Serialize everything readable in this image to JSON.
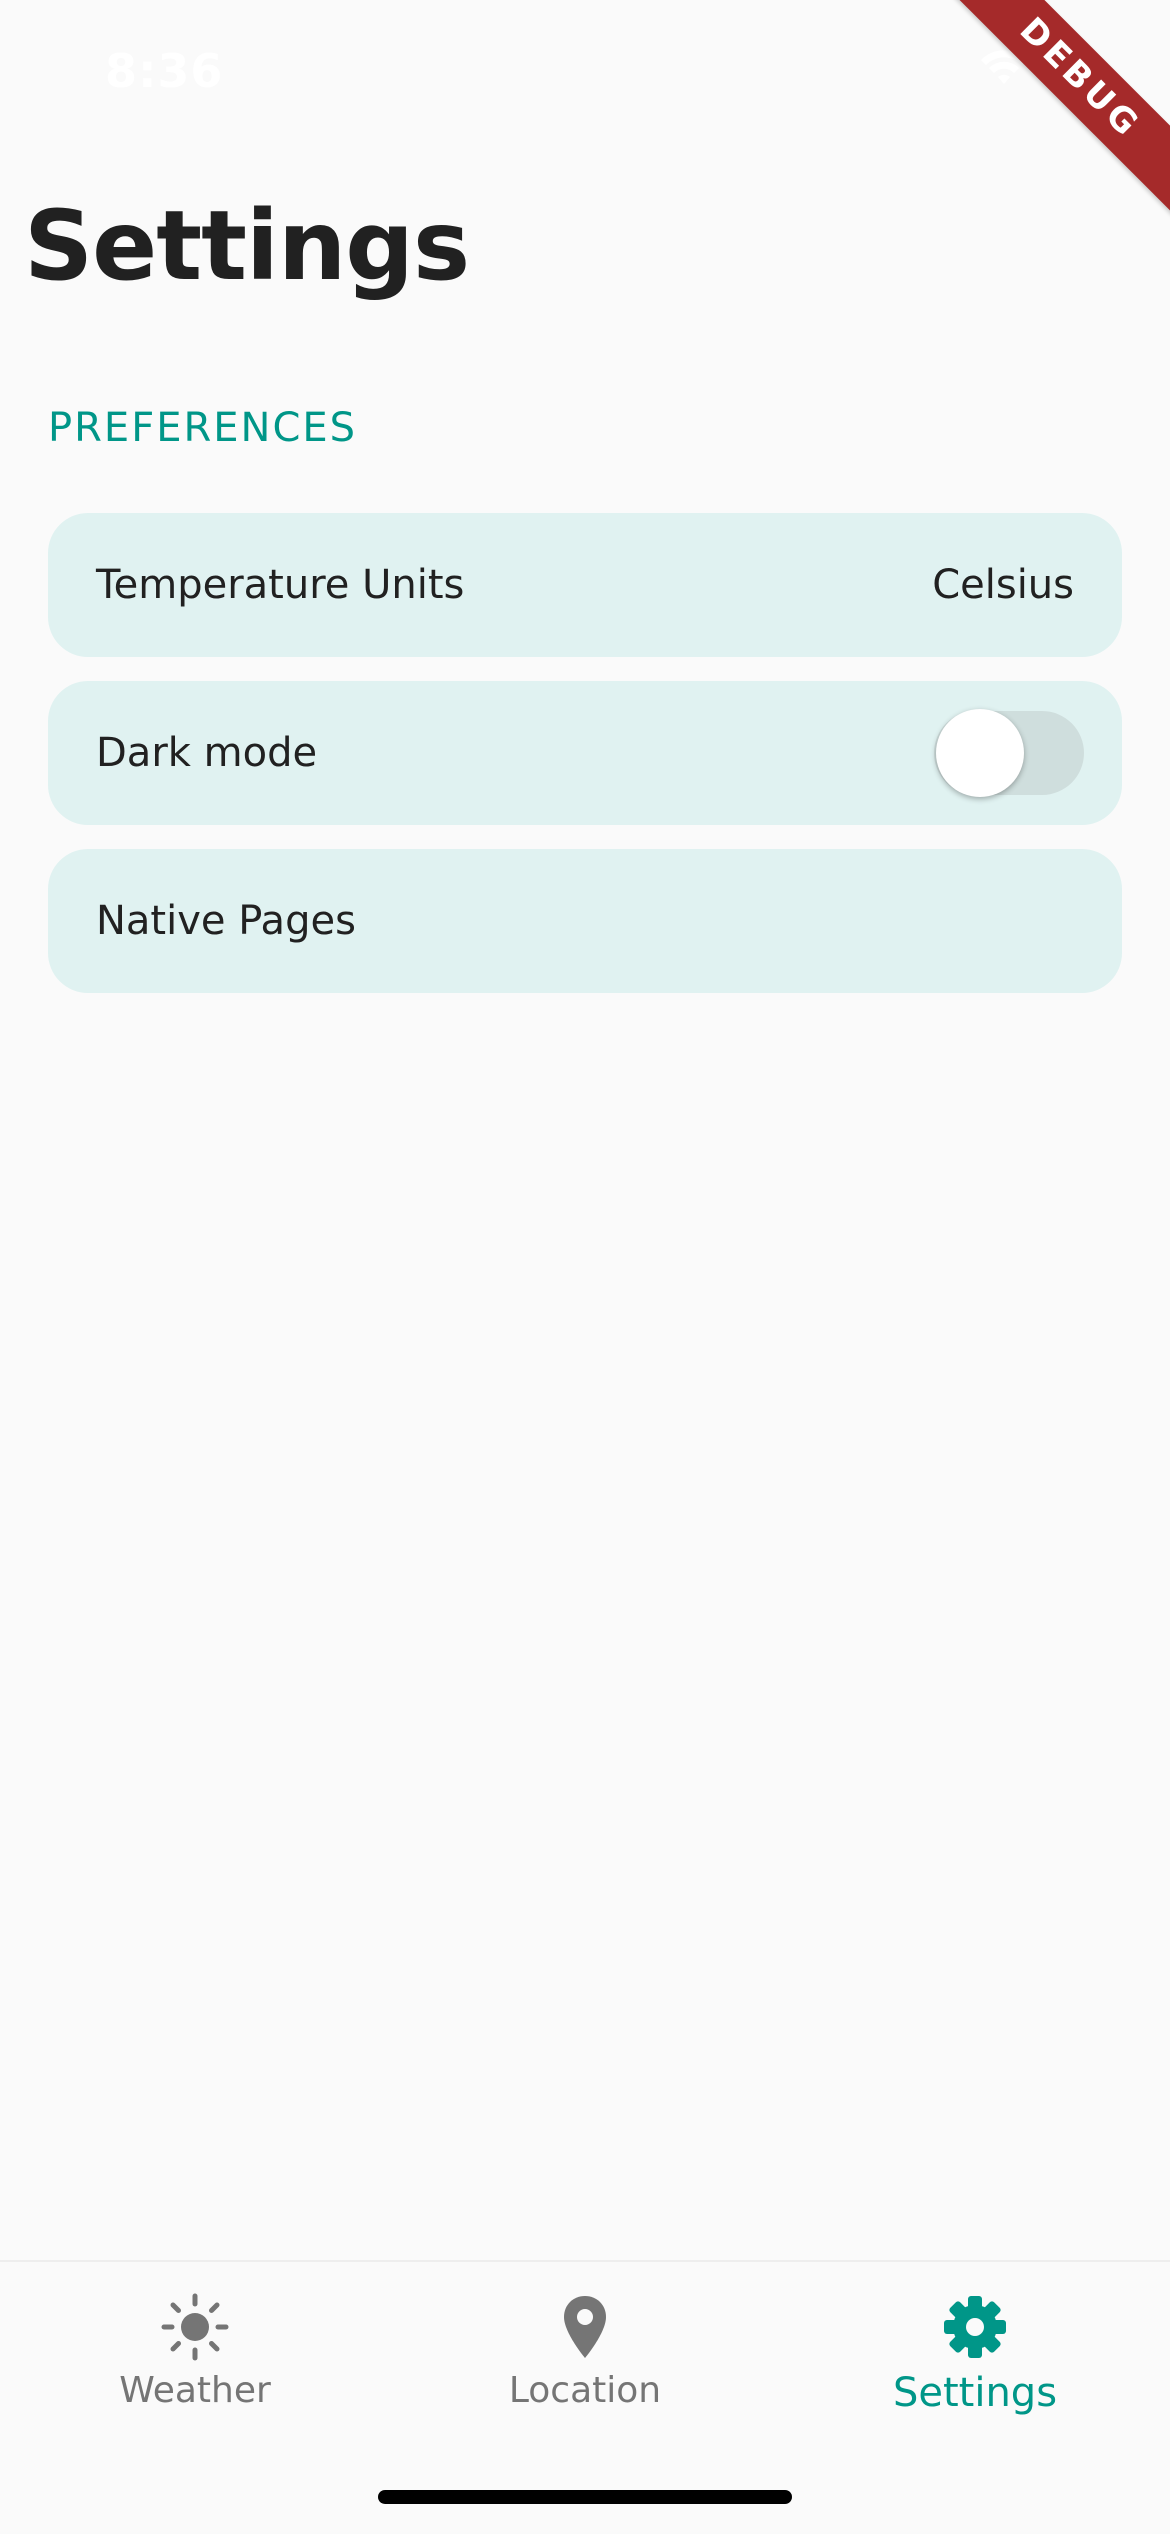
{
  "status_bar": {
    "time": "8:36",
    "debug_label": "DEBUG"
  },
  "page": {
    "title": "Settings"
  },
  "section": {
    "title": "PREFERENCES"
  },
  "settings": {
    "temperature_units": {
      "label": "Temperature Units",
      "value": "Celsius"
    },
    "dark_mode": {
      "label": "Dark mode",
      "enabled": false
    },
    "native_pages": {
      "label": "Native Pages"
    }
  },
  "bottom_nav": {
    "items": [
      {
        "label": "Weather",
        "icon": "sun-icon"
      },
      {
        "label": "Location",
        "icon": "location-pin-icon"
      },
      {
        "label": "Settings",
        "icon": "gear-icon"
      }
    ],
    "selected": "Settings"
  },
  "colors": {
    "accent": "#009688",
    "card_background": "#e0f2f1",
    "background": "#fafafa",
    "inactive": "#757575"
  }
}
